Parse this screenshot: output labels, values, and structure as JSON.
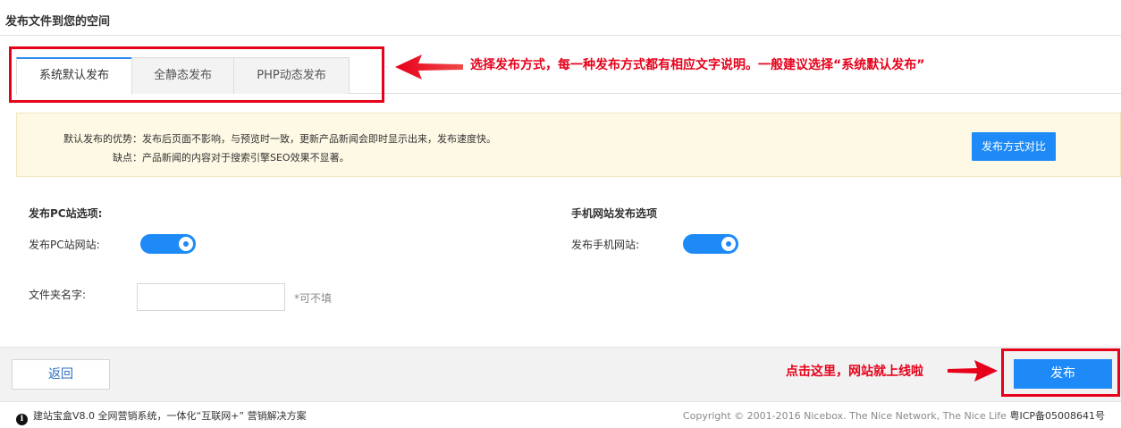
{
  "header": {
    "title": "发布文件到您的空间"
  },
  "tabs": [
    {
      "label": "系统默认发布",
      "active": true
    },
    {
      "label": "全静态发布",
      "active": false
    },
    {
      "label": "PHP动态发布",
      "active": false
    }
  ],
  "annotations": {
    "tabs_note": "选择发布方式，每一种发布方式都有相应文字说明。一般建议选择“系统默认发布”",
    "publish_note": "点击这里，网站就上线啦"
  },
  "notice": {
    "advantage_key": "默认发布的优势：",
    "advantage_value": "发布后页面不影响，与预览时一致，更新产品新闻会即时显示出来，发布速度快。",
    "disadvantage_key": "缺点：",
    "disadvantage_value": "产品新闻的内容对于搜索引擎SEO效果不显著。",
    "compare_button": "发布方式对比"
  },
  "pc_options": {
    "title": "发布PC站选项:",
    "toggle_label": "发布PC站网站:",
    "enabled": true
  },
  "mobile_options": {
    "title": "手机网站发布选项",
    "toggle_label": "发布手机网站:",
    "enabled": true
  },
  "folder": {
    "label": "文件夹名字:",
    "value": "",
    "hint": "*可不填"
  },
  "actions": {
    "back": "返回",
    "publish": "发布"
  },
  "footer": {
    "left": "建站宝盒V8.0 全网营销系统，一体化“互联网+” 营销解决方案",
    "copyright": "Copyright © 2001-2016 Nicebox. The Nice Network, The Nice Life",
    "icp": "粤ICP备05008641号"
  },
  "colors": {
    "accent": "#1d8af7",
    "annotation": "#e6001a",
    "notice_bg": "#fdf9e4"
  },
  "icons": {
    "info": "info-icon",
    "arrow": "left-arrow-icon"
  }
}
